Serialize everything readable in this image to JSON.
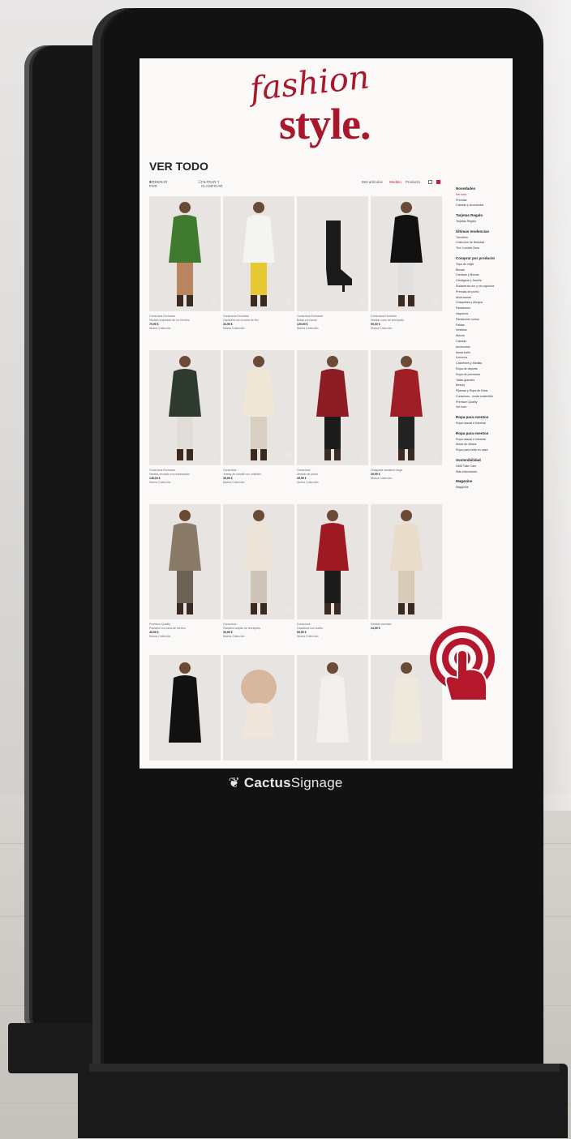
{
  "brand": {
    "name_bold": "Cactus",
    "name_rest": "Signage"
  },
  "screen": {
    "logo_script": "fashion",
    "logo_main": "style.",
    "title": "VER TODO",
    "toolbar": {
      "sort": "ORDENAR POR",
      "filter": "FILTRAR Y CLASIFICAR",
      "count": "552 artículos",
      "model": "Modelo",
      "product": "Producto"
    },
    "products": [
      {
        "label": "Conscious Exclusive",
        "name": "Vestido drapeado de un hombro",
        "price": "79,99 €",
        "tag": "Nueva Colección"
      },
      {
        "label": "Conscious Exclusive",
        "name": "Camiseta con broche de flor",
        "price": "34,99 €",
        "tag": "Nueva Colección"
      },
      {
        "label": "Conscious Exclusive",
        "name": "Botas con tacón",
        "price": "129,99 €",
        "tag": "Nueva Colección"
      },
      {
        "label": "Conscious Exclusive",
        "name": "Vestido corto de terciopelo",
        "price": "99,00 €",
        "tag": "Nueva Colección"
      },
      {
        "label": "Conscious Exclusive",
        "name": "Vestido cruzado con estampado",
        "price": "149,00 €",
        "tag": "Nueva Colección"
      },
      {
        "label": "Conscious",
        "name": "Jersey de canalé con volantes",
        "price": "39,99 €",
        "tag": "Nueva Colección"
      },
      {
        "label": "Conscious",
        "name": "Vestido de punto",
        "price": "39,99 €",
        "tag": "Nueva Colección"
      },
      {
        "label": "",
        "name": "Chaqueta camisera larga",
        "price": "39,99 €",
        "tag": "Nueva Colección"
      },
      {
        "label": "Premium Quality",
        "name": "Pantalón con lana de merino",
        "price": "49,99 €",
        "tag": "Nueva Colección"
      },
      {
        "label": "Conscious",
        "name": "Pantalón amplio de terciopelo",
        "price": "39,99 €",
        "tag": "Nueva Colección"
      },
      {
        "label": "Conscious",
        "name": "Cazadora con cuello",
        "price": "59,99 €",
        "tag": "Nueva Colección"
      },
      {
        "label": "",
        "name": "Vestido oversize",
        "price": "24,99 €",
        "tag": ""
      }
    ],
    "sidebar": [
      {
        "h": "Novedades",
        "items": [
          "Ver todo",
          "Prendas",
          "Calzado y Accesorios"
        ]
      },
      {
        "h": "Tarjetas Regalo",
        "items": [
          "Tarjetas Regalo"
        ]
      },
      {
        "h": "Últimas tendencias",
        "items": [
          "Trendelin",
          "Colección de Navidad",
          "The Comfort Zone"
        ]
      },
      {
        "h": "Comprar por producto",
        "items": [
          "Tops de mujer",
          "Blusas",
          "Camisas y Blusas",
          "Cárdigans y Jerséis",
          "Sudaderas con y sin capucha",
          "Prendas de punto",
          "Americanas",
          "Chaquetas y Abrigos",
          "Pantalones",
          "Vaqueros",
          "Pantalones cortos",
          "Faldas",
          "Vestidos",
          "Monos",
          "Calzado",
          "Accesorios",
          "Moda baño",
          "Lencería",
          "Calcetines y Medias",
          "Ropa de deporte",
          "Ropa de premamá",
          "Tallas grandes",
          "Beauty",
          "Pijamas y Ropa de Estar",
          "Conscious - moda sostenible",
          "Premium Quality",
          "Ver todo"
        ]
      },
      {
        "h": "Ropa para eventos",
        "items": [
          "Ropa casual e informal"
        ]
      },
      {
        "h": "Ropa para eventos",
        "items": [
          "Ropa casual e informal",
          "Moda de oficina",
          "Ropa para estar en casa"
        ]
      },
      {
        "h": "Sostenibilidad",
        "items": [
          "H&M Take Care",
          "Más información"
        ]
      },
      {
        "h": "Magazine",
        "items": [
          "Magazine"
        ]
      }
    ]
  },
  "colors": {
    "accent": "#a8172b",
    "kiosk": "#121212"
  }
}
